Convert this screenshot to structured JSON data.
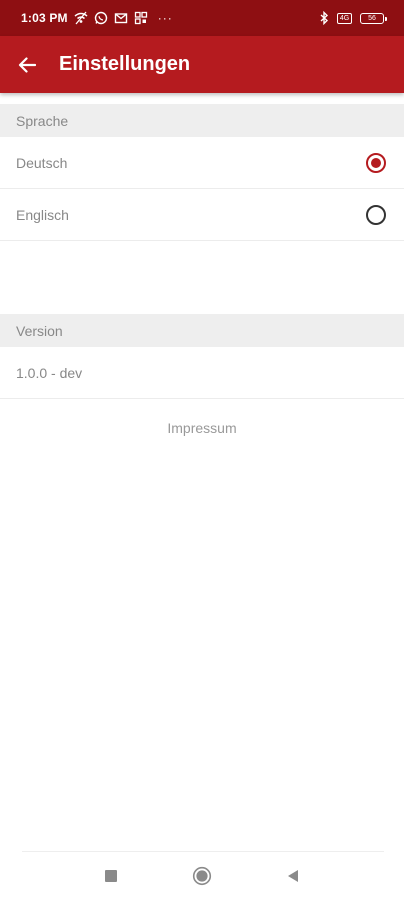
{
  "status_bar": {
    "time": "1:03 PM",
    "more": "···",
    "sim_label": "4G",
    "battery_level": "56"
  },
  "app_bar": {
    "title": "Einstellungen",
    "back_icon": "arrow-back-icon"
  },
  "sections": {
    "language": {
      "header": "Sprache",
      "options": [
        {
          "label": "Deutsch",
          "selected": true
        },
        {
          "label": "Englisch",
          "selected": false
        }
      ]
    },
    "version": {
      "header": "Version",
      "value": "1.0.0 - dev"
    }
  },
  "impressum_label": "Impressum",
  "colors": {
    "status_bar": "#8e0f12",
    "app_bar": "#b51b1f",
    "accent": "#b51b1f",
    "section_header_bg": "#eeeeee",
    "muted_text": "#888888"
  },
  "nav_bar": {
    "icons": [
      "recent-apps-icon",
      "home-icon",
      "back-icon"
    ]
  }
}
